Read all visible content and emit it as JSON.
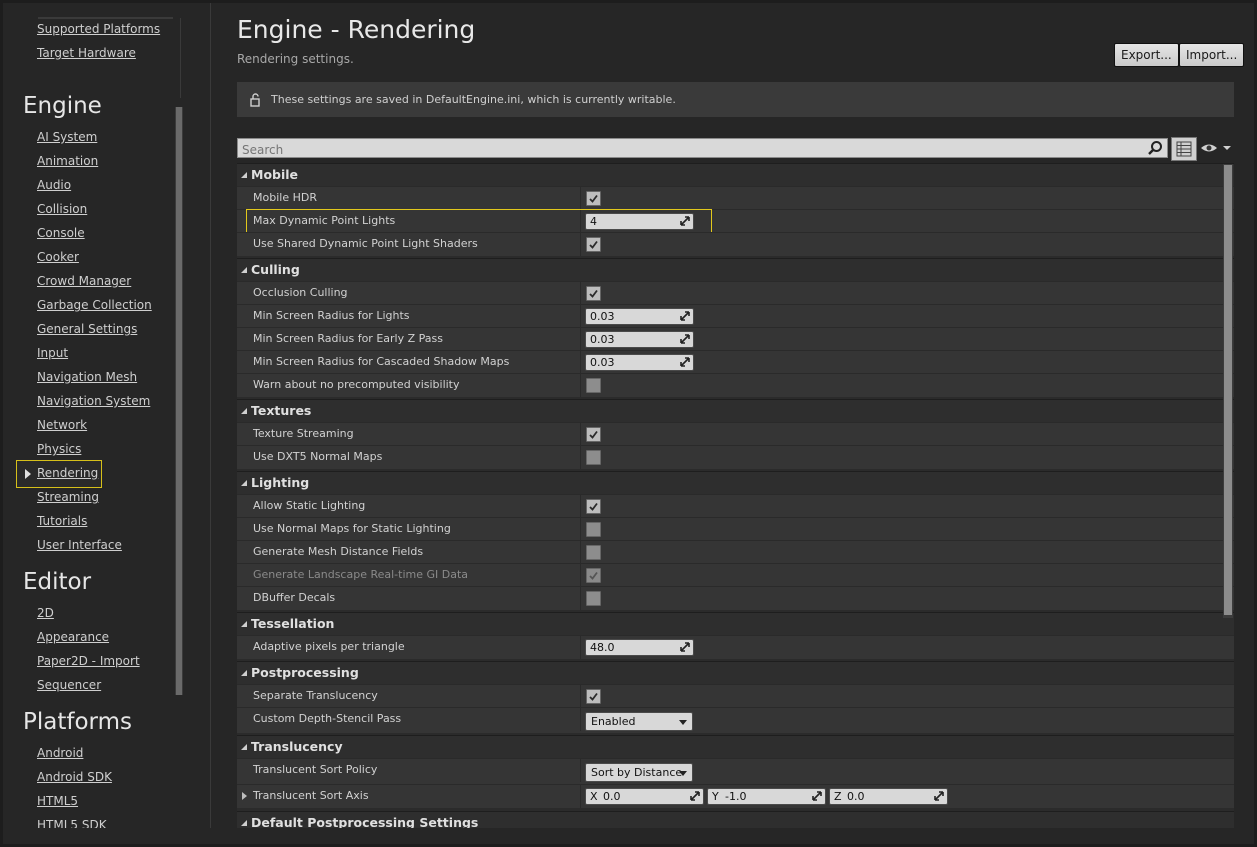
{
  "sidebar": {
    "top_links": [
      "Supported Platforms",
      "Target Hardware"
    ],
    "sections": [
      {
        "title": "Engine",
        "items": [
          "AI System",
          "Animation",
          "Audio",
          "Collision",
          "Console",
          "Cooker",
          "Crowd Manager",
          "Garbage Collection",
          "General Settings",
          "Input",
          "Navigation Mesh",
          "Navigation System",
          "Network",
          "Physics",
          "Rendering",
          "Streaming",
          "Tutorials",
          "User Interface"
        ]
      },
      {
        "title": "Editor",
        "items": [
          "2D",
          "Appearance",
          "Paper2D - Import",
          "Sequencer"
        ]
      },
      {
        "title": "Platforms",
        "items": [
          "Android",
          "Android SDK",
          "HTML5",
          "HTML5 SDK"
        ]
      }
    ],
    "selected_item": "Rendering"
  },
  "header": {
    "title": "Engine - Rendering",
    "subtitle": "Rendering settings.",
    "export_label": "Export...",
    "import_label": "Import..."
  },
  "notice": {
    "text": "These settings are saved in DefaultEngine.ini, which is currently writable."
  },
  "search": {
    "placeholder": "Search"
  },
  "categories": {
    "mobile": {
      "title": "Mobile",
      "mobile_hdr": {
        "label": "Mobile HDR",
        "checked": true
      },
      "max_point_lights": {
        "label": "Max Dynamic Point Lights",
        "value": "4"
      },
      "shared_shaders": {
        "label": "Use Shared Dynamic Point Light Shaders",
        "checked": true
      }
    },
    "culling": {
      "title": "Culling",
      "occlusion": {
        "label": "Occlusion Culling",
        "checked": true
      },
      "radius_lights": {
        "label": "Min Screen Radius for Lights",
        "value": "0.03"
      },
      "radius_earlyz": {
        "label": "Min Screen Radius for Early Z Pass",
        "value": "0.03"
      },
      "radius_shadow": {
        "label": "Min Screen Radius for Cascaded Shadow Maps",
        "value": "0.03"
      },
      "warn_visibility": {
        "label": "Warn about no precomputed visibility",
        "checked": false
      }
    },
    "textures": {
      "title": "Textures",
      "streaming": {
        "label": "Texture Streaming",
        "checked": true
      },
      "dxt5": {
        "label": "Use DXT5 Normal Maps",
        "checked": false
      }
    },
    "lighting": {
      "title": "Lighting",
      "static_lighting": {
        "label": "Allow Static Lighting",
        "checked": true
      },
      "normal_maps_static": {
        "label": "Use Normal Maps for Static Lighting",
        "checked": false
      },
      "distance_fields": {
        "label": "Generate Mesh Distance Fields",
        "checked": false
      },
      "landscape_gi": {
        "label": "Generate Landscape Real-time GI Data",
        "checked": true
      },
      "dbuffer": {
        "label": "DBuffer Decals",
        "checked": false
      }
    },
    "tessellation": {
      "title": "Tessellation",
      "adaptive_pixels": {
        "label": "Adaptive pixels per triangle",
        "value": "48.0"
      }
    },
    "postprocessing": {
      "title": "Postprocessing",
      "separate_translucency": {
        "label": "Separate Translucency",
        "checked": true
      },
      "depth_stencil": {
        "label": "Custom Depth-Stencil Pass",
        "value": "Enabled"
      }
    },
    "translucency": {
      "title": "Translucency",
      "sort_policy": {
        "label": "Translucent Sort Policy",
        "value": "Sort by Distance"
      },
      "sort_axis": {
        "label": "Translucent Sort Axis",
        "x_label": "X",
        "x": "0.0",
        "y_label": "Y",
        "y": "-1.0",
        "z_label": "Z",
        "z": "0.0"
      }
    },
    "default_pp": {
      "title": "Default Postprocessing Settings"
    }
  },
  "colors": {
    "highlight": "#e2c81c",
    "background": "#262626"
  }
}
